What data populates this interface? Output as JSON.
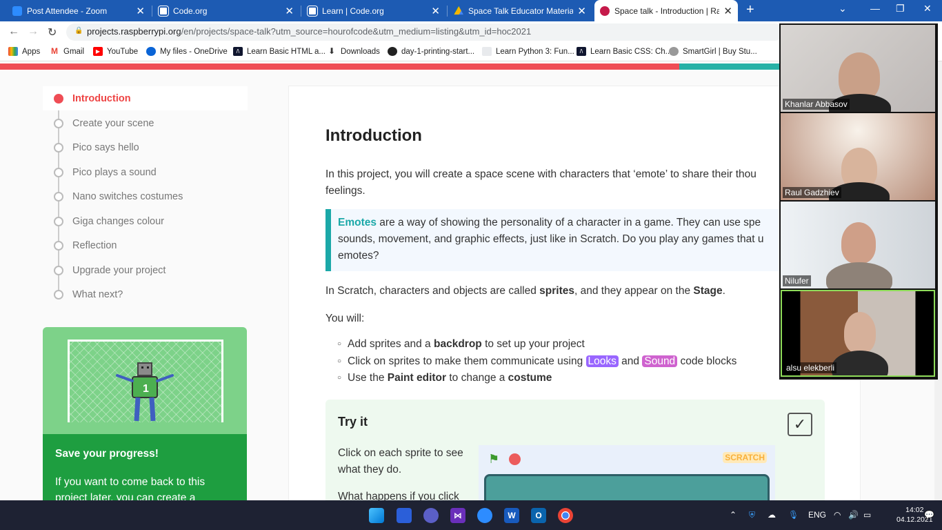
{
  "browser": {
    "tabs": [
      {
        "title": "Post Attendee - Zoom",
        "favicon_color": "#2d8cff"
      },
      {
        "title": "Code.org",
        "favicon_color": "#ffffff"
      },
      {
        "title": "Learn | Code.org",
        "favicon_color": "#ffffff"
      },
      {
        "title": "Space Talk Educator Materials - G",
        "favicon_color": "#f4b400"
      },
      {
        "title": "Space talk - Introduction | Raspbe",
        "favicon_color": "#c51a4a"
      }
    ],
    "url_domain": "projects.raspberrypi.org",
    "url_path": "/en/projects/space-talk?utm_source=hourofcode&utm_medium=listing&utm_id=hoc2021",
    "bookmarks": [
      "Apps",
      "Gmail",
      "YouTube",
      "My files - OneDrive",
      "Learn Basic HTML a...",
      "Downloads",
      "day-1-printing-start...",
      "Learn Python 3: Fun...",
      "Learn Basic CSS: Ch...",
      "SmartGirl | Buy Stu..."
    ]
  },
  "sidebar": {
    "steps": [
      "Introduction",
      "Create your scene",
      "Pico says hello",
      "Pico plays a sound",
      "Nano switches costumes",
      "Giga changes colour",
      "Reflection",
      "Upgrade your project",
      "What next?"
    ],
    "save_title": "Save your progress!",
    "save_text": "If you want to come back to this project later, you can create a"
  },
  "content": {
    "heading": "Introduction",
    "intro_l1": "In this project, you will create a space scene with characters that ‘emote’ to share their thou",
    "intro_l2": "feelings.",
    "callout_em": "Emotes",
    "callout_l1": " are a way of showing the personality of a character in a game. They can use spe",
    "callout_l2": "sounds, movement, and graphic effects, just like in Scratch. Do you play any games that u",
    "callout_l3": "emotes?",
    "sprites_pre": "In Scratch, characters and objects are called ",
    "sprites_bold": "sprites",
    "sprites_mid": ", and they appear on the ",
    "sprites_stage": "Stage",
    "sprites_end": ".",
    "you_will": "You will:",
    "b1_pre": "Add sprites and a ",
    "b1_bold": "backdrop",
    "b1_end": " to set up your project",
    "b2_pre": "Click on sprites to make them communicate using ",
    "b2_looks": "Looks",
    "b2_and": " and ",
    "b2_sound": "Sound",
    "b2_end": " code blocks",
    "b3_pre": "Use the ",
    "b3_bold": "Paint editor",
    "b3_mid": " to change a ",
    "b3_bold2": "costume",
    "tryit_title": "Try it",
    "tryit_p1": "Click on each sprite to see what they do.",
    "tryit_p2": "What happens if you click",
    "scratch_logo": "SCRATCH",
    "looks_color": "#9966ff",
    "sound_color": "#cf63cf"
  },
  "zoom": {
    "participants": [
      "Khanlar Abbasov",
      "Raul Gadzhiev",
      "Nilufer",
      "alsu elekberli"
    ]
  },
  "taskbar": {
    "lang": "ENG",
    "time": "14:02",
    "date": "04.12.2021"
  }
}
